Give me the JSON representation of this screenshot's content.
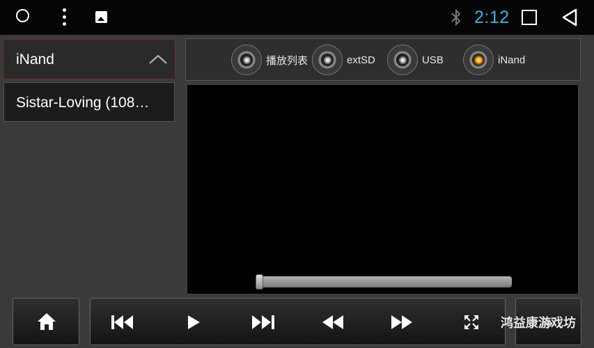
{
  "status_bar": {
    "time": "2:12",
    "time_color": "#33b5e5",
    "icons": [
      "circle-icon",
      "more-vert-icon",
      "image-icon",
      "bluetooth-icon",
      "recents-square-icon",
      "back-triangle-icon"
    ]
  },
  "source_dropdown": {
    "label": "iNand",
    "icon": "chevron-up-icon"
  },
  "file_list": [
    {
      "label": "Sistar-Loving (108…"
    }
  ],
  "sources": [
    {
      "label": "播放列表",
      "selected": false
    },
    {
      "label": "extSD",
      "selected": false
    },
    {
      "label": "USB",
      "selected": false
    },
    {
      "label": "iNand",
      "selected": true
    }
  ],
  "player": {
    "progress": 0.0
  },
  "controls": {
    "home": "home-icon",
    "transport": [
      "previous-track-icon",
      "play-icon",
      "next-track-icon",
      "rewind-icon",
      "fast-forward-icon",
      "fullscreen-icon"
    ],
    "back": "return-icon"
  },
  "watermark": "鸿益康游戏坊",
  "accent_selected": "#ff8c00"
}
